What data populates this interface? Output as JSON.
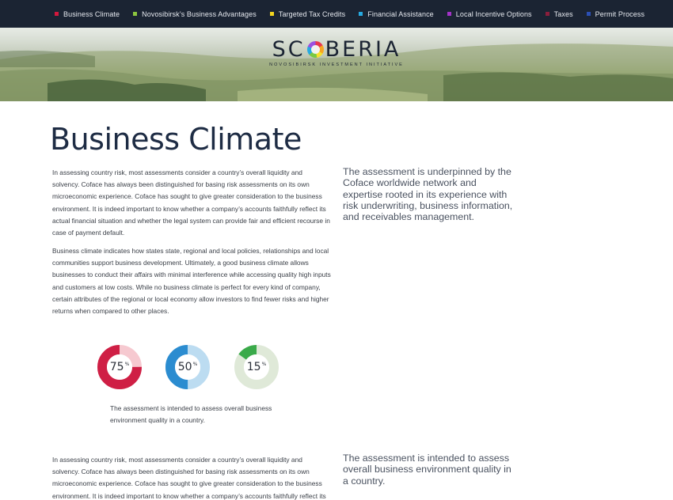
{
  "nav": {
    "items": [
      {
        "label": "Business Climate",
        "color": "#d4183d"
      },
      {
        "label": "Novosibirsk’s Business Advantages",
        "color": "#8cc63f"
      },
      {
        "label": "Targeted Tax Credits",
        "color": "#f2d41f"
      },
      {
        "label": "Financial Assistance",
        "color": "#27aae1"
      },
      {
        "label": "Local Incentive Options",
        "color": "#a332c8"
      },
      {
        "label": "Taxes",
        "color": "#8a1e3c"
      },
      {
        "label": "Permit Process",
        "color": "#2b4fb3"
      }
    ]
  },
  "logo": {
    "text_left": "SC",
    "text_right": "BERIA",
    "tagline": "NOVOSIBIRSK INVESTMENT INITIATIVE"
  },
  "page": {
    "title": "Business Climate"
  },
  "content": {
    "paragraph_1": "In assessing country risk, most assessments consider a country’s overall liquidity and solvency. Coface has always been distinguished for basing risk assessments on its own microeconomic experience. Coface has sought to give greater consideration to the business environment. It is indeed important to know whether a company’s accounts faithfully reflect its actual financial situation and whether the legal system can provide fair and efficient recourse in case of payment default.",
    "paragraph_2": "Business climate indicates how states state, regional and local policies, relationships and local communities support business development. Ultimately, a good business climate allows businesses to conduct their affairs with minimal interference while accessing quality high inputs and customers at low costs. While no business climate is perfect for every kind of company, certain attributes of the regional or local economy allow investors to find fewer risks and higher returns when compared to other places.",
    "paragraph_3": "In assessing country risk, most assessments consider a country’s overall liquidity and solvency. Coface has always been distinguished for basing risk assessments on its own microeconomic experience. Coface has sought to give greater consideration to the business environment. It is indeed important to know whether a company’s accounts faithfully reflect its",
    "pullquote_1": "The assessment is underpinned by the Coface worldwide network and expertise rooted in its experience with risk underwriting, business information, and receivables management.",
    "pullquote_2": "The assessment is intended to assess overall business environment quality in a country."
  },
  "chart_data": {
    "type": "pie",
    "items": [
      {
        "value": 75,
        "label": "75",
        "unit": "%",
        "color": "#cf1f45",
        "track": "#f6c9d0"
      },
      {
        "value": 50,
        "label": "50",
        "unit": "%",
        "color": "#2b8cd0",
        "track": "#bcdcf1"
      },
      {
        "value": 15,
        "label": "15",
        "unit": "%",
        "color": "#3aaa4a",
        "track": "#dfe9d8"
      }
    ],
    "caption": "The assessment is intended to assess overall business environment quality in a country."
  }
}
